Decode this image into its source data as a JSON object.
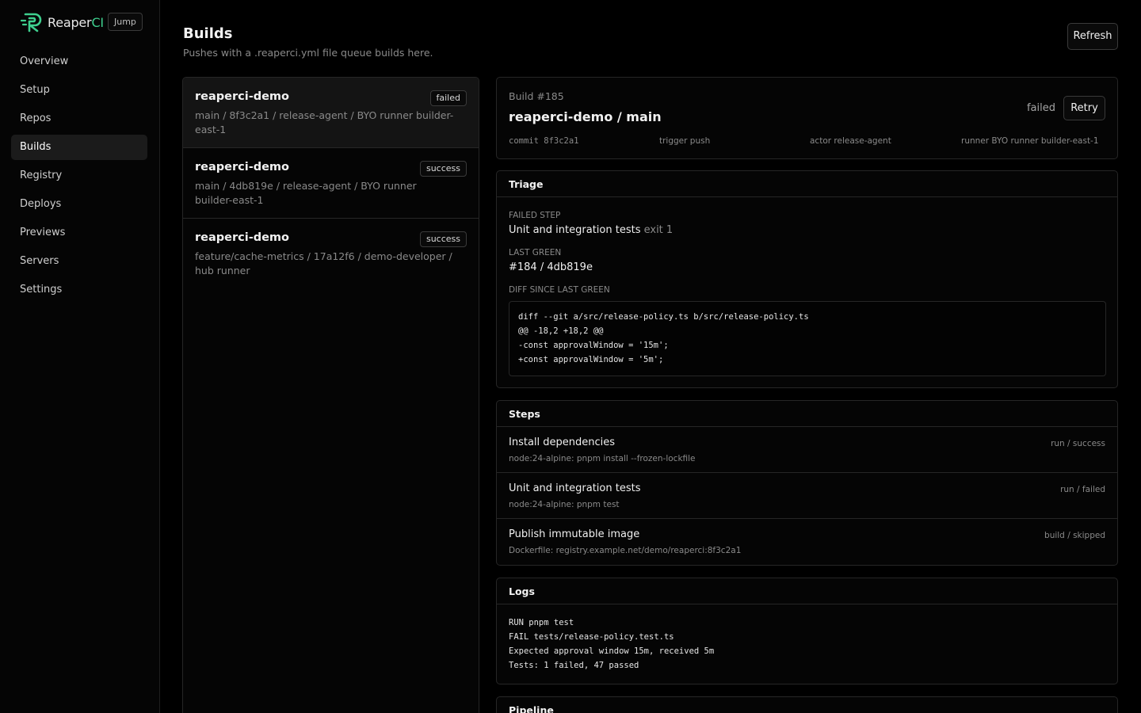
{
  "app": {
    "brand_main": "Reaper",
    "brand_accent": "CI",
    "jump_label": "Jump",
    "accent_color": "#3ecf8e"
  },
  "sidebar": {
    "items": [
      {
        "label": "Overview",
        "active": false
      },
      {
        "label": "Setup",
        "active": false
      },
      {
        "label": "Repos",
        "active": false
      },
      {
        "label": "Builds",
        "active": true
      },
      {
        "label": "Registry",
        "active": false
      },
      {
        "label": "Deploys",
        "active": false
      },
      {
        "label": "Previews",
        "active": false
      },
      {
        "label": "Servers",
        "active": false
      },
      {
        "label": "Settings",
        "active": false
      }
    ]
  },
  "header": {
    "title": "Builds",
    "subtitle": "Pushes with a .reaperci.yml file queue builds here.",
    "refresh_label": "Refresh"
  },
  "builds": [
    {
      "repo": "reaperci-demo",
      "status": "failed",
      "meta": "main / 8f3c2a1 / release-agent / BYO runner builder-east-1"
    },
    {
      "repo": "reaperci-demo",
      "status": "success",
      "meta": "main / 4db819e / release-agent / BYO runner builder-east-1"
    },
    {
      "repo": "reaperci-demo",
      "status": "success",
      "meta": "feature/cache-metrics / 17a12f6 / demo-developer / hub runner"
    }
  ],
  "detail": {
    "build_number": "Build #185",
    "title": "reaperci-demo / main",
    "status": "failed",
    "retry_label": "Retry",
    "commit": "commit 8f3c2a1",
    "trigger": "trigger push",
    "actor": "actor release-agent",
    "runner": "runner BYO runner builder-east-1"
  },
  "triage": {
    "title": "Triage",
    "failed_step_label": "Failed step",
    "failed_step_value": "Unit and integration tests",
    "failed_step_exit": "exit 1",
    "last_green_label": "Last green",
    "last_green_value": "#184 / 4db819e",
    "diff_label": "Diff since last green",
    "diff_lines": [
      "diff --git a/src/release-policy.ts b/src/release-policy.ts",
      "@@ -18,2 +18,2 @@",
      "-const approvalWindow = '15m';",
      "+const approvalWindow = '5m';"
    ]
  },
  "steps": {
    "title": "Steps",
    "items": [
      {
        "name": "Install dependencies",
        "command": "node:24-alpine: pnpm install --frozen-lockfile",
        "status": "run / success"
      },
      {
        "name": "Unit and integration tests",
        "command": "node:24-alpine: pnpm test",
        "status": "run / failed"
      },
      {
        "name": "Publish immutable image",
        "command": "Dockerfile: registry.example.net/demo/reaperci:8f3c2a1",
        "status": "build / skipped"
      }
    ]
  },
  "logs": {
    "title": "Logs",
    "lines": [
      "RUN pnpm test",
      "FAIL tests/release-policy.test.ts",
      "Expected approval window 15m, received 5m",
      "Tests: 1 failed, 47 passed"
    ]
  },
  "pipeline": {
    "title": "Pipeline"
  }
}
